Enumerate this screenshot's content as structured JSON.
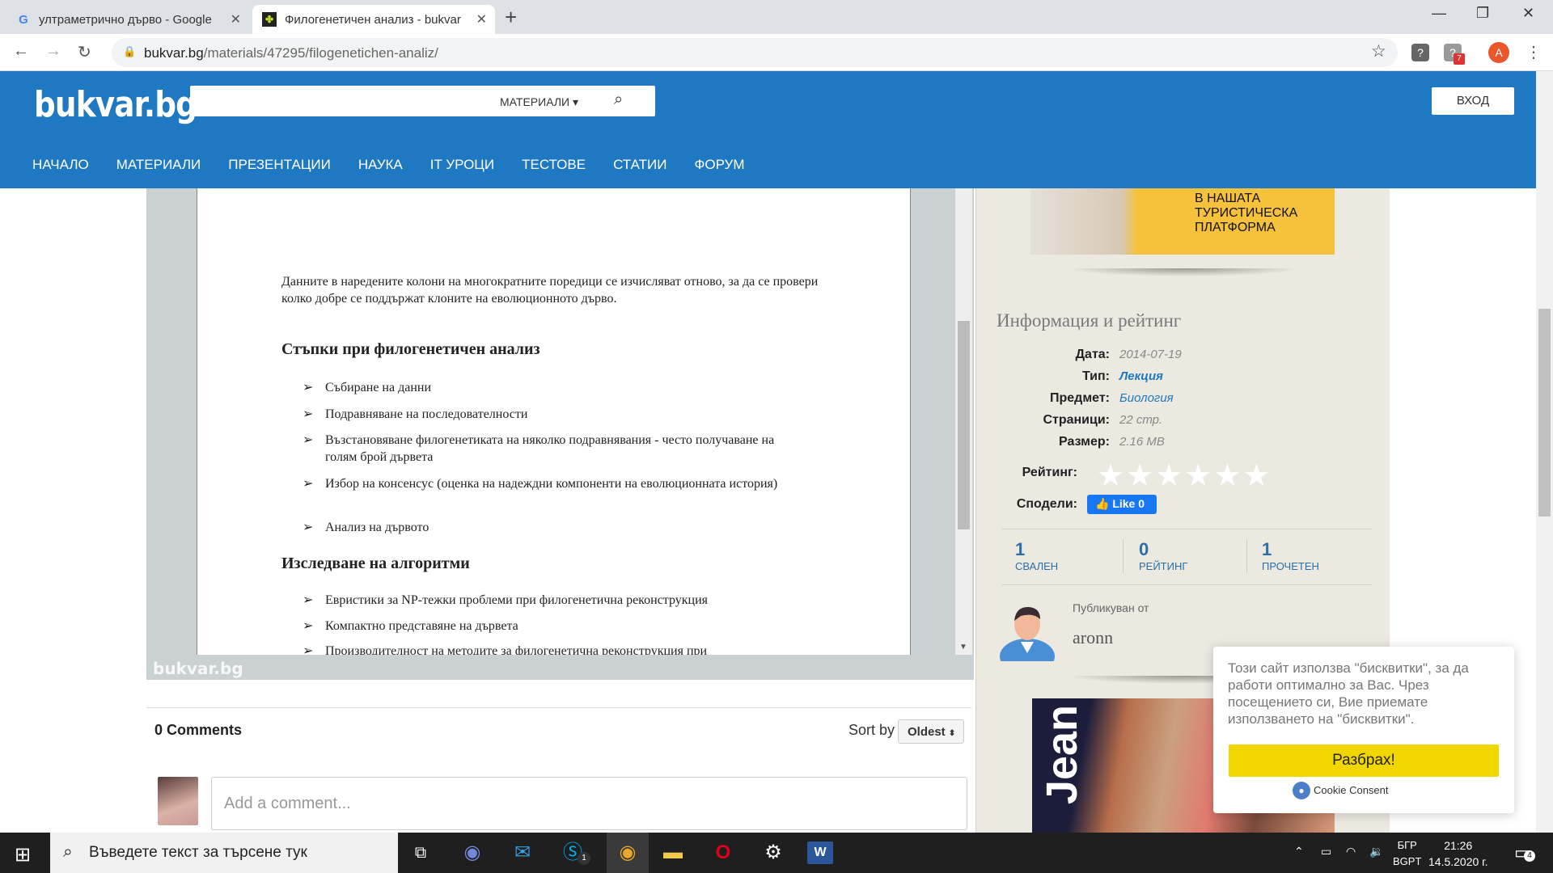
{
  "browser": {
    "tabs": [
      {
        "title": "ултраметрично дърво - Google",
        "favicon": "google-icon"
      },
      {
        "title": "Филогенетичен анализ - bukvar",
        "favicon": "bukvar-icon"
      }
    ],
    "url_host": "bukvar.bg",
    "url_path": "/materials/47295/filogenetichen-analiz/",
    "profile_initial": "A",
    "ext_badge": "7"
  },
  "site": {
    "logo": "bukvar.bg",
    "search_placeholder": "",
    "materials_dropdown": "МАТЕРИАЛИ",
    "login": "ВХОД",
    "menu": [
      "НАЧАЛО",
      "МАТЕРИАЛИ",
      "ПРЕЗЕНТАЦИИ",
      "НАУКА",
      "IT УРОЦИ",
      "ТЕСТОВЕ",
      "СТАТИИ",
      "ФОРУМ"
    ]
  },
  "document": {
    "paragraph": "Данните в наредените колони на многократните поредици се изчисляват отново, за да се провери колко добре се поддържат клоните на еволюционното дърво.",
    "heading1": "Стъпки при филогенетичен анализ",
    "steps": [
      "Събиране на данни",
      "Подравняване на последователности",
      "Възстановяване филогенетиката на няколко подравнявания - често получаване на голям брой дървета",
      "Избор на консенсус (оценка на надеждни компоненти на еволюционната история)",
      "Анализ на дървото"
    ],
    "heading2": "Изследване на алгоритми",
    "algorithms": [
      "Евристики за NP-тежки проблеми при филогенетична реконструкция",
      "Компактно представяне на дървета",
      "Производителност на методите за филогенетична реконструкция при"
    ],
    "watermark": "bukvar.bg"
  },
  "comments": {
    "count": "0 Comments",
    "sort_label": "Sort by",
    "sort_value": "Oldest",
    "placeholder": "Add a comment..."
  },
  "sidebar": {
    "ad_text": "В НАШАТА ТУРИСТИЧЕСКА ПЛАТФОРМА",
    "info_title": "Информация и рейтинг",
    "date_label": "Дата:",
    "date": "2014-07-19",
    "type_label": "Тип:",
    "type": "Лекция",
    "subject_label": "Предмет:",
    "subject": "Биология",
    "pages_label": "Страници:",
    "pages": "22 стр.",
    "size_label": "Размер:",
    "size": "2.16 MB",
    "rating_label": "Рейтинг:",
    "rating_value": 0,
    "rating_max": 6,
    "share_label": "Сподели:",
    "like": "Like 0",
    "stats": [
      {
        "n": "1",
        "l": "СВАЛЕН"
      },
      {
        "n": "0",
        "l": "РЕЙТИНГ"
      },
      {
        "n": "1",
        "l": "ПРОЧЕТЕН"
      }
    ],
    "published_by": "Публикуван от",
    "author": "aronn",
    "ad2_text": "Jean"
  },
  "cookie": {
    "text": "Този сайт използва \"бисквитки\", за да работи оптимално за Вас. Чрез посещението си, Вие приемате използването на \"бисквитки\".",
    "button": "Разбрах!",
    "brand": "Cookie Consent"
  },
  "taskbar": {
    "search_placeholder": "Въведете текст за търсене тук",
    "lang_top": "БГР",
    "lang_bottom": "BGPT",
    "time": "21:26",
    "date": "14.5.2020 г.",
    "notif_count": "4",
    "skype_badge": "1"
  }
}
